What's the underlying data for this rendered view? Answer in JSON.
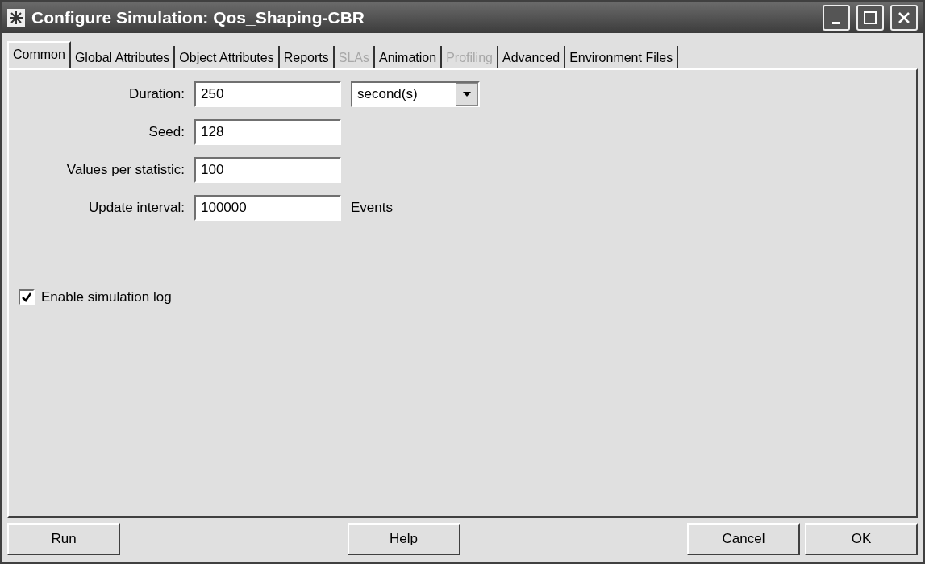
{
  "window": {
    "title": "Configure Simulation: Qos_Shaping-CBR"
  },
  "tabs": [
    {
      "label": "Common",
      "selected": true,
      "disabled": false
    },
    {
      "label": "Global Attributes",
      "selected": false,
      "disabled": false
    },
    {
      "label": "Object Attributes",
      "selected": false,
      "disabled": false
    },
    {
      "label": "Reports",
      "selected": false,
      "disabled": false
    },
    {
      "label": "SLAs",
      "selected": false,
      "disabled": true
    },
    {
      "label": "Animation",
      "selected": false,
      "disabled": false
    },
    {
      "label": "Profiling",
      "selected": false,
      "disabled": true
    },
    {
      "label": "Advanced",
      "selected": false,
      "disabled": false
    },
    {
      "label": "Environment Files",
      "selected": false,
      "disabled": false
    }
  ],
  "fields": [
    {
      "label": "Duration:",
      "value": "250",
      "kind": "select",
      "unit": "second(s)"
    },
    {
      "label": "Seed:",
      "value": "128",
      "kind": "plain"
    },
    {
      "label": "Values per statistic:",
      "value": "100",
      "kind": "plain"
    },
    {
      "label": "Update interval:",
      "value": "100000",
      "kind": "suffix",
      "unit": "Events"
    }
  ],
  "checkbox": {
    "label": "Enable simulation log",
    "checked": true
  },
  "buttons": [
    "Run",
    "Help",
    "Cancel",
    "OK"
  ]
}
